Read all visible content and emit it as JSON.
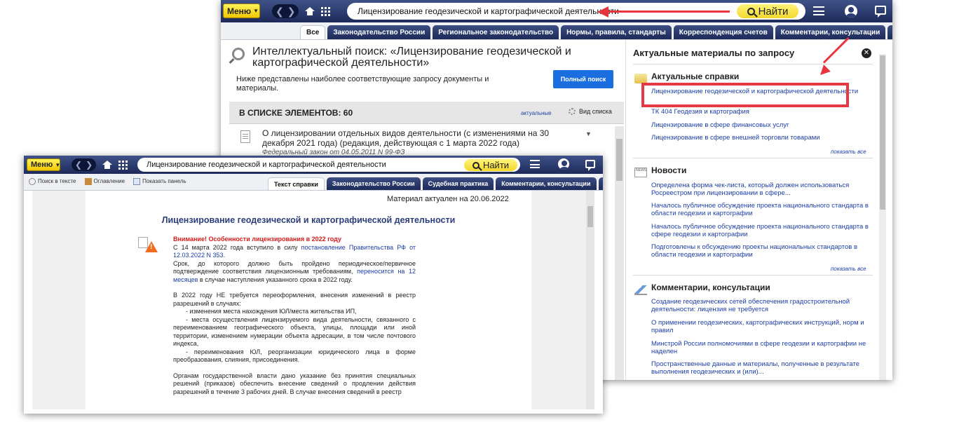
{
  "back": {
    "menu_label": "Меню",
    "search_value": "Лицензирование геодезической и картографической деятельности",
    "find_label": "Найти",
    "tabs": [
      {
        "label": "Все"
      },
      {
        "label": "Законодательство России"
      },
      {
        "label": "Региональное законодательство"
      },
      {
        "label": "Нормы, правила, стандарты"
      },
      {
        "label": "Корреспонденция счетов"
      },
      {
        "label": "Комментарии, консультации"
      }
    ],
    "left": {
      "title": "Интеллектуальный поиск: «Лицензирование геодезической и картографической деятельности»",
      "description": "Ниже представлены наиболее соответствующие запросу документы и материалы.",
      "full_search_label": "Полный поиск",
      "list_count": "В СПИСКЕ ЭЛЕМЕНТОВ: 60",
      "actual_link": "актуальные",
      "view_list_label": "Вид списка",
      "doc": {
        "title": "О лицензировании отдельных видов деятельности (с изменениями на 30 декабря 2021 года) (редакция, действующая с 1 марта 2022 года)",
        "subtitle": "Федеральный закон от 04.05.2011 N 99-ФЗ"
      }
    },
    "right": {
      "title": "Актуальные материалы по запросу",
      "show_all": "показать все",
      "sections": [
        {
          "title": "Актуальные справки",
          "links": [
            "Лицензирование геодезической и картографической деятельности",
            "ТК 404 Геодезия и картография",
            "Лицензирование в сфере финансовых услуг",
            "Лицензирование в сфере внешней торговли товарами"
          ]
        },
        {
          "title": "Новости",
          "links": [
            "Определена форма чек-листа, который должен использоваться Росреестром при лицензировании в сфере...",
            "Началось публичное обсуждение проекта национального стандарта в области геодезии и картографии",
            "Началось публичное обсуждение проекта национального стандарта в сфере геодезии и картографии",
            "Подготовлены к обсуждению проекты национальных стандартов в области геодезии и картографии"
          ]
        },
        {
          "title": "Комментарии, консультации",
          "links": [
            "Создание геодезических сетей обеспечения градостроительной деятельности: лицензия не требуется",
            "О применении геодезических, картографических инструкций, норм и правил",
            "Минстрой России полномочиями в сфере геодезии и картографии не наделен",
            "Пространственные данные и материалы, полученные в результате выполнения геодезических и (или)..."
          ]
        }
      ],
      "news_icon_text": "NEWS"
    }
  },
  "front": {
    "menu_label": "Меню",
    "search_value": "Лицензирование геодезической и картографической деятельности",
    "find_label": "Найти",
    "tools": [
      "Поиск в тексте",
      "Оглавление",
      "Показать панель"
    ],
    "tabs": [
      {
        "label": "Текст справки"
      },
      {
        "label": "Законодательство России"
      },
      {
        "label": "Судебная практика"
      },
      {
        "label": "Комментарии, консультации"
      }
    ],
    "doc": {
      "date": "Материал актуален на 20.06.2022",
      "title": "Лицензирование геодезической и картографической деятельности",
      "warning": "Внимание! Особенности лицензирования в 2022 году",
      "p1_a": "С 14 марта 2022 года вступило в силу ",
      "p1_link": "постановление Правительства РФ от 12.03.2022 N 353",
      "p1_b": ".",
      "p2_a": "Срок, до которого должно быть пройдено периодическое/первичное подтверждение соответствия лицензионным требованиям, ",
      "p2_link": "переносится на 12 месяцев",
      "p2_b": " в случае наступления указанного срока в 2022 году.",
      "p3": "В 2022 году НЕ требуется переоформления, внесения изменений в реестр разрешений в случаях:",
      "p4": "- изменения места нахождения ЮЛ/места жительства ИП,",
      "p5": "- места осуществления лицензируемого вида деятельности, связанного с переименованием географического объекта, улицы, площади или иной территории, изменением нумерации объекта адресации, в том числе почтового индекса,",
      "p6": "- переименования ЮЛ, реорганизации юридического лица в форме преобразования, слияния, присоединения.",
      "p7": "Органам государственной власти дано указание без принятия специальных решений (приказов) обеспечить внесение сведений о продлении действия разрешений в течение 3 рабочих дней. В случае внесения сведений в реестр"
    }
  },
  "colors": {
    "accent_red": "#e63a42",
    "nav_dark": "#1d2a5a",
    "link_blue": "#1c3ea8",
    "button_yellow": "#f2d82c",
    "full_search_blue": "#1a6ee0"
  }
}
